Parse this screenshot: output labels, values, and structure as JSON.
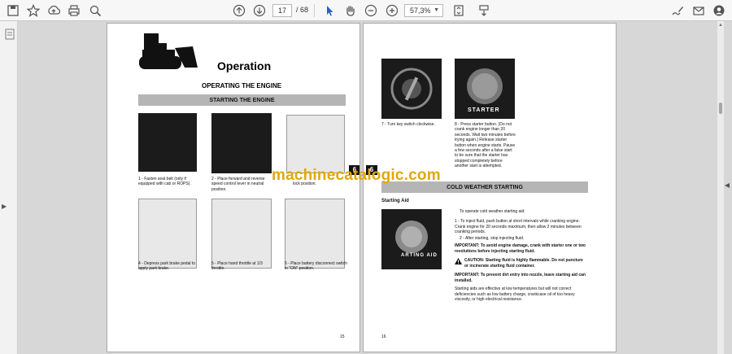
{
  "toolbar": {
    "page_current": "17",
    "page_total": "/ 68",
    "zoom": "57,3%",
    "icons": [
      "save-icon",
      "star-icon",
      "upload-icon",
      "print-icon",
      "zoom-search-icon",
      "page-up-icon",
      "page-down-icon",
      "select-cursor-icon",
      "hand-icon",
      "zoom-out-icon",
      "zoom-in-icon",
      "fit-page-icon",
      "scroll-mode-icon",
      "sign-icon",
      "mail-icon",
      "account-icon"
    ]
  },
  "left_page": {
    "heading": "Operation",
    "subheading": "OPERATING THE ENGINE",
    "banner": "STARTING THE ENGINE",
    "captions": [
      "1 - Fasten seat belt (only if equipped with cab or ROPS).",
      "2 - Place forward and reverse speed control lever in neutral position.",
      "lock position.",
      "4 - Depress park brake pedal to apply park brake.",
      "5 - Place hand throttle at 1/3 throttle.",
      "6 - Place battery disconnect switch in \"ON\" position."
    ],
    "tab": "6",
    "page_number": "15"
  },
  "right_page": {
    "captions": [
      "7 - Turn key switch clockwise.",
      "8 - Press starter button. (Do not crank engine longer than 20 seconds. Wait two minutes before trying again.) Release starter button when engine starts. Pause a few seconds after a false start to be sure that the starter has stopped completely before another start is attempted."
    ],
    "starter_label": "STARTER",
    "tab": "6",
    "banner": "COLD WEATHER STARTING",
    "starting_aid_title": "Starting Aid",
    "aid_label": "ARTING AID",
    "intro": "To operate cold weather starting aid:",
    "step1": "1 - To inject fluid, push button at short intervals while cranking engine. Crank engine for 20 seconds maximum, then allow 2 minutes between cranking periods.",
    "step2": "2 - After starting, stop injecting fluid.",
    "important1": "IMPORTANT: To avoid engine damage, crank with starter one or two revolutions before injecting starting fluid.",
    "caution": "CAUTION: Starting fluid is highly flammable. Do not puncture or incinerate starting fluid container.",
    "important2": "IMPORTANT: To prevent dirt entry into nozzle, leave starting aid can installed.",
    "closing": "Starting aids are effective at low temperatures but will not correct deficiencies such as low battery charge, crankcase oil of too heavy viscosity, or high electrical resistance.",
    "page_number": "16"
  },
  "watermark": "machinecatalogic.com"
}
